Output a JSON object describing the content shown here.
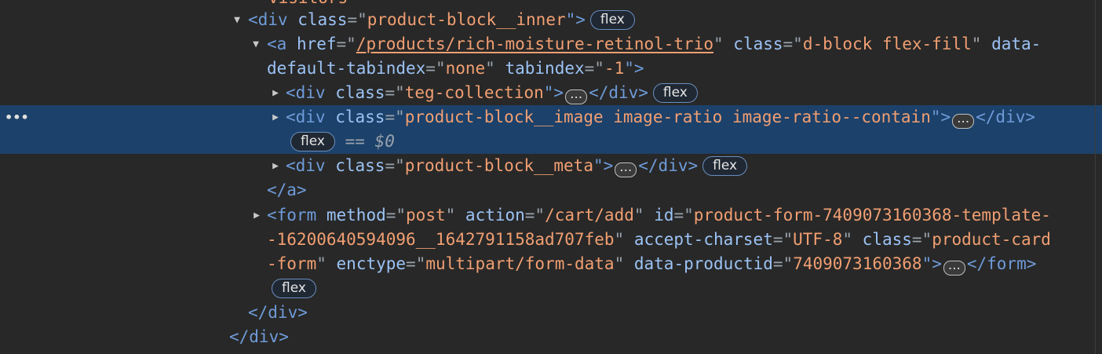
{
  "partial_top": "visitors",
  "r1": {
    "open": "<div",
    "attr": "class",
    "eq": "=\"",
    "val": "product-block__inner",
    "close": "\">",
    "badge": "flex"
  },
  "r2": {
    "open": "<a",
    "href_attr": "href",
    "eq1": "=\"",
    "href_val": "/products/rich-moisture-retinol-trio",
    "q1": "\"",
    "class_attr": "class",
    "eq2": "=\"",
    "class_val": "d-block flex-fill",
    "q2": "\"",
    "data_attr_start": "data-"
  },
  "r3": {
    "data_attr_end": "default-tabindex",
    "eq1": "=\"",
    "val1": "none",
    "q1": "\"",
    "tab_attr": "tabindex",
    "eq2": "=\"",
    "val2": "-1",
    "close": "\">"
  },
  "r4": {
    "open": "<div",
    "attr": "class",
    "eq": "=\"",
    "val": "teg-collection",
    "close": "\">",
    "end": "</div>",
    "badge": "flex"
  },
  "r5": {
    "open": "<div",
    "attr": "class",
    "eq": "=\"",
    "val": "product-block__image image-ratio image-ratio--contain",
    "close": "\">",
    "end": "</div>"
  },
  "r6": {
    "badge": "flex",
    "eqsign": "==",
    "ref": "$0"
  },
  "r7": {
    "open": "<div",
    "attr": "class",
    "eq": "=\"",
    "val": "product-block__meta",
    "close": "\">",
    "end": "</div>",
    "badge": "flex"
  },
  "r8": {
    "end": "</a>"
  },
  "r9": {
    "open": "<form",
    "a1": "method",
    "v1": "post",
    "a2": "action",
    "v2": "/cart/add",
    "a3": "id",
    "v3": "product-form-7409073160368-template-"
  },
  "r10": {
    "v3b": "-16200640594096__1642791158ad707feb",
    "a4": "accept-charset",
    "v4": "UTF-8",
    "a5": "class",
    "v5": "product-card"
  },
  "r11": {
    "v5b": "-form",
    "a6": "enctype",
    "v6": "multipart/form-data",
    "a7": "data-productid",
    "v7": "7409073160368",
    "close": "\">",
    "end": "</form>"
  },
  "r12": {
    "badge": "flex"
  },
  "r13": {
    "end": "</div>"
  },
  "r14": {
    "end": "</div>"
  },
  "icons": {
    "expanded": "triangle-down-icon",
    "collapsed": "triangle-right-icon",
    "ellipsis": "ellipsis-icon",
    "row_menu": "more-dots-icon"
  },
  "colors": {
    "background": "#282828",
    "selection": "#1c416a",
    "tag": "#6e9bd9",
    "attr": "#9cc3f5",
    "value": "#f19f72"
  }
}
